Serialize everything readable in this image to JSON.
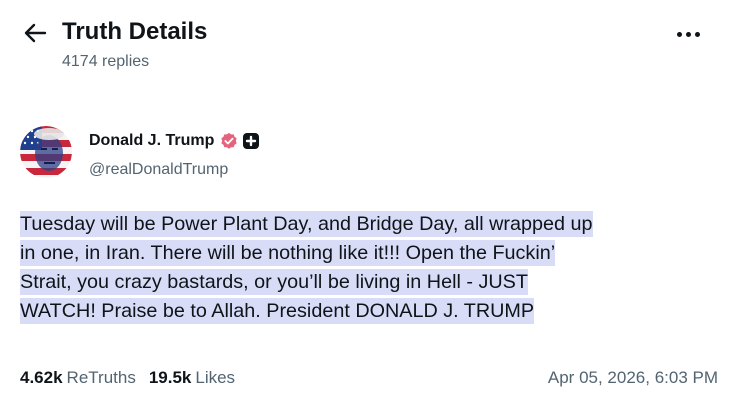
{
  "header": {
    "title": "Truth Details",
    "replies": "4174 replies",
    "back_icon": "arrow-left-icon",
    "more_icon": "more-horizontal-icon"
  },
  "author": {
    "name": "Donald J. Trump",
    "handle": "@realDonaldTrump",
    "verified_color": "#e4637d"
  },
  "post": {
    "line1": "Tuesday will be Power Plant Day, and Bridge Day, all wrapped up",
    "line2": "in one, in Iran. There will be nothing like it!!! Open the Fuckin’",
    "line3": "Strait, you crazy bastards, or you’ll be living in Hell - JUST",
    "line4": "WATCH! Praise be to Allah. President DONALD J. TRUMP",
    "highlight_color": "#d8dcf7"
  },
  "stats": {
    "retruths_count": "4.62k",
    "retruths_label": "ReTruths",
    "likes_count": "19.5k",
    "likes_label": "Likes",
    "timestamp": "Apr 05, 2026, 6:03 PM"
  }
}
